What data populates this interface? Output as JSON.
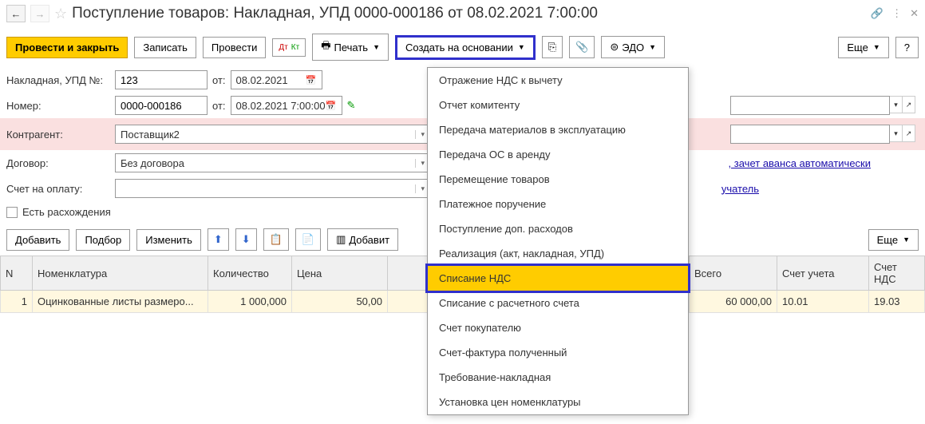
{
  "header": {
    "title": "Поступление товаров: Накладная, УПД 0000-000186 от 08.02.2021 7:00:00"
  },
  "toolbar": {
    "post_close": "Провести и закрыть",
    "save": "Записать",
    "post": "Провести",
    "print": "Печать",
    "create_based": "Создать на основании",
    "edo": "ЭДО",
    "more": "Еще",
    "help": "?"
  },
  "form": {
    "invoice_label": "Накладная, УПД №:",
    "invoice_no": "123",
    "from_label": "от:",
    "invoice_date": "08.02.2021",
    "number_label": "Номер:",
    "number": "0000-000186",
    "number_date": "08.02.2021  7:00:00",
    "contragent_label": "Контрагент:",
    "contragent": "Поставщик2",
    "contract_label": "Договор:",
    "contract": "Без договора",
    "contract_link": ", зачет аванса автоматически",
    "account_label": "Счет на оплату:",
    "recipient_link": "учатель",
    "discrepancy": "Есть расхождения"
  },
  "table_toolbar": {
    "add": "Добавить",
    "select": "Подбор",
    "edit": "Изменить",
    "add2": "Добавит",
    "more": "Еще"
  },
  "table": {
    "headers": {
      "n": "N",
      "nomenclature": "Номенклатура",
      "qty": "Количество",
      "price": "Цена",
      "total": "Всего",
      "acc": "Счет учета",
      "vat_acc": "Счет НДС"
    },
    "rows": [
      {
        "n": "1",
        "nom": "Оцинкованные листы размеро...",
        "qty": "1 000,000",
        "price": "50,00",
        "total": "60 000,00",
        "acc": "10.01",
        "vat_acc": "19.03"
      }
    ]
  },
  "dropdown": {
    "items": [
      "Отражение НДС к вычету",
      "Отчет комитенту",
      "Передача материалов в эксплуатацию",
      "Передача ОС в аренду",
      "Перемещение товаров",
      "Платежное поручение",
      "Поступление доп. расходов",
      "Реализация (акт, накладная, УПД)",
      "Списание НДС",
      "Списание с расчетного счета",
      "Счет покупателю",
      "Счет-фактура полученный",
      "Требование-накладная",
      "Установка цен номенклатуры"
    ],
    "selected_index": 8
  }
}
